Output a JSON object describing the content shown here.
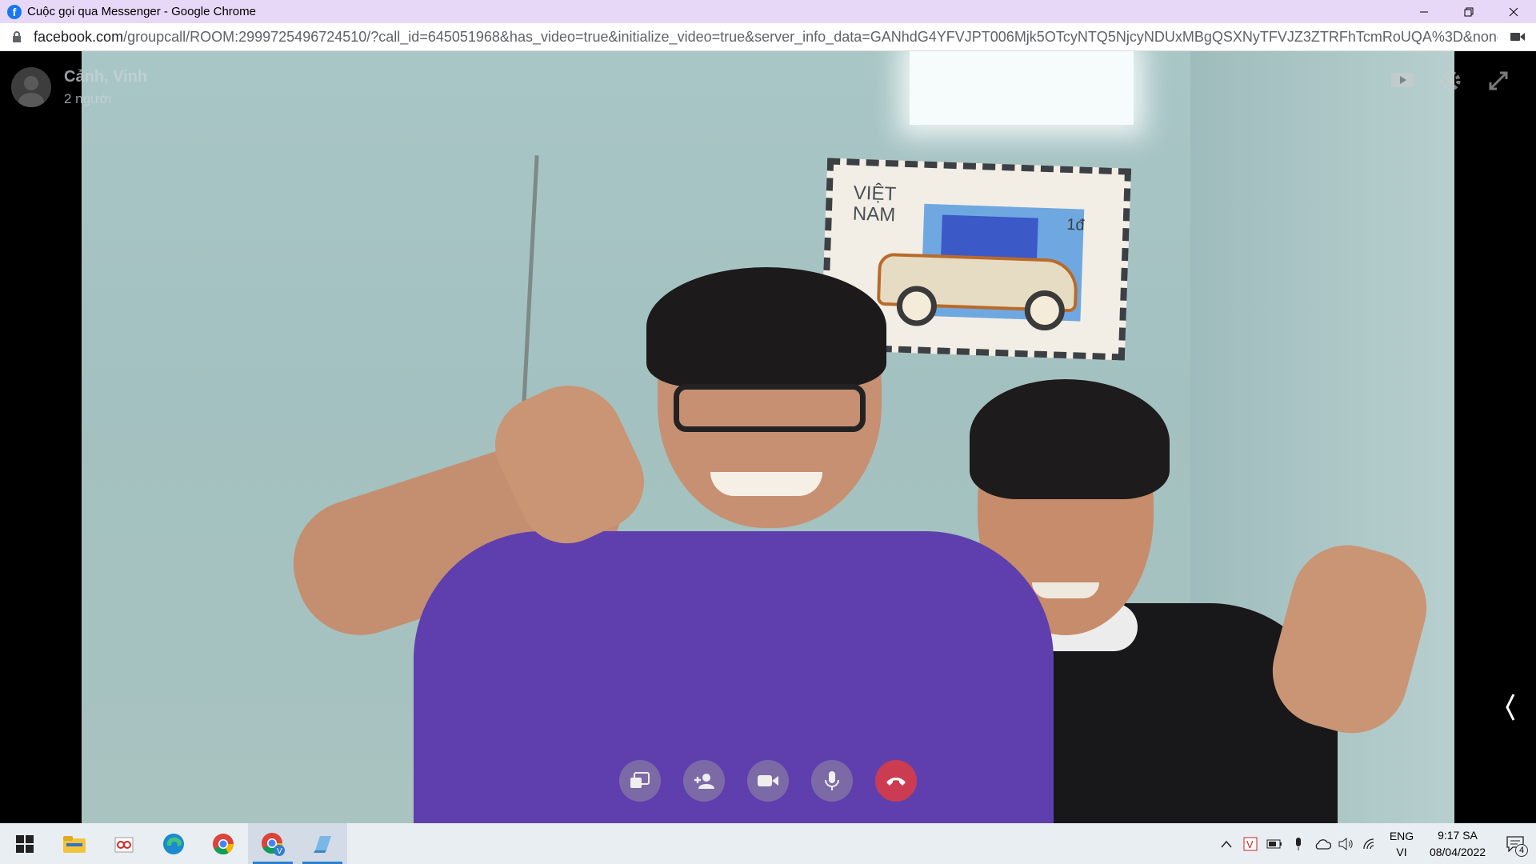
{
  "window": {
    "title": "Cuộc gọi qua Messenger - Google Chrome"
  },
  "address": {
    "host": "facebook.com",
    "path": "/groupcall/ROOM:2999725496724510/?call_id=645051968&has_video=true&initialize_video=true&server_info_data=GANhdG4YFVJPT006Mjk5OTcyNTQ5NjcyNDUxMBgQSXNyTFVJZ3ZTRFhTcmRoUQA%3D&nonce=mky0b..."
  },
  "call": {
    "title": "Cảnh, Vinh",
    "participants": "2 người"
  },
  "stamp": {
    "label": "VIỆT\nNAM",
    "value": "1đ"
  },
  "taskbar": {
    "lang_top": "ENG",
    "lang_bottom": "VI",
    "time": "9:17 SA",
    "date": "08/04/2022",
    "notif_count": "4"
  },
  "colors": {
    "end_call": "#e63c3c",
    "accent": "#2d7fd0",
    "facebook": "#1877f2"
  }
}
